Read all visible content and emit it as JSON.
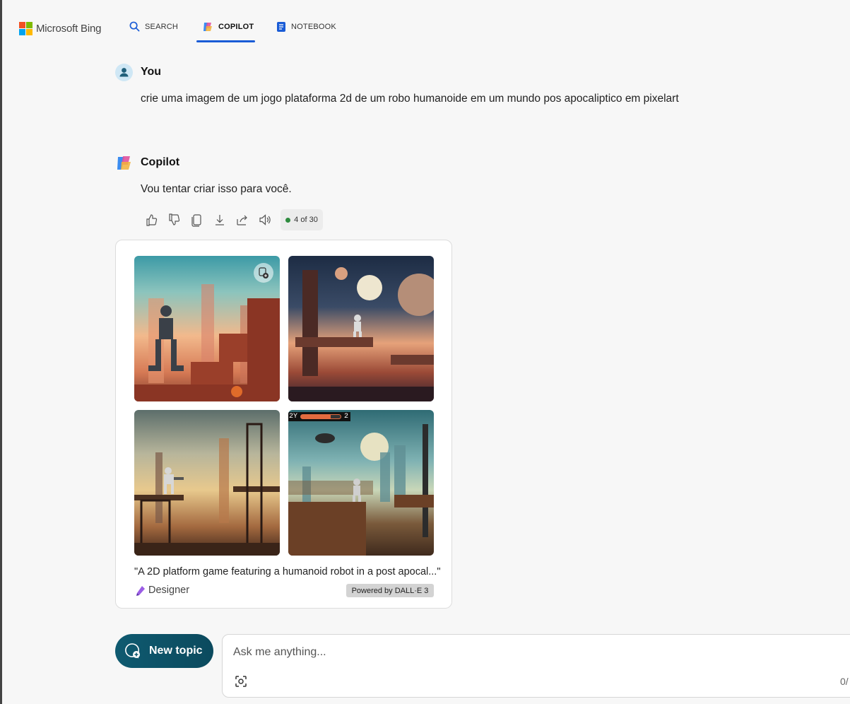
{
  "header": {
    "brand": "Microsoft Bing",
    "nav": [
      {
        "label": "SEARCH",
        "icon": "search-icon"
      },
      {
        "label": "COPILOT",
        "icon": "copilot-icon"
      },
      {
        "label": "NOTEBOOK",
        "icon": "notebook-icon"
      }
    ],
    "active_tab": "COPILOT",
    "accent_color": "#1a5cd6"
  },
  "conversation": {
    "user": {
      "name": "You",
      "message": "crie uma imagem de um jogo plataforma 2d de um robo humanoide em um mundo pos apocaliptico em pixelart"
    },
    "copilot": {
      "name": "Copilot",
      "message": "Vou tentar criar isso para você.",
      "actions": [
        "thumbs-up-icon",
        "thumbs-down-icon",
        "copy-icon",
        "download-icon",
        "share-icon",
        "speaker-icon"
      ],
      "counter": "4 of 30",
      "counter_dot_color": "#2e8b3e"
    }
  },
  "image_card": {
    "images": [
      {
        "label": ""
      },
      {
        "label": ""
      },
      {
        "label": ""
      },
      {
        "label": ""
      }
    ],
    "hud_text_left": "2Y",
    "hud_text_right": "2",
    "caption": "\"A 2D platform game featuring a humanoid robot in a post apocal...\"",
    "source": "Designer",
    "badge": "Powered by DALL·E 3"
  },
  "composer": {
    "new_topic_label": "New topic",
    "placeholder": "Ask me anything...",
    "char_count": "0/"
  }
}
